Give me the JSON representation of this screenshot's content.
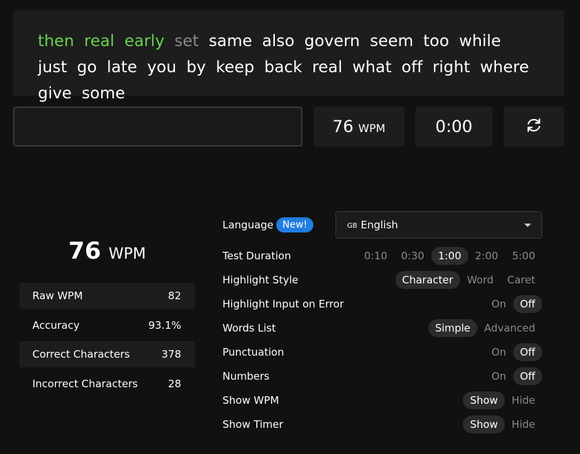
{
  "typing_text": {
    "completed": [
      "then",
      "real",
      "early"
    ],
    "current": "set",
    "pending": [
      "same",
      "also",
      "govern",
      "seem",
      "too",
      "while",
      "just",
      "go",
      "late",
      "you",
      "by",
      "keep",
      "back",
      "real",
      "what",
      "off",
      "right",
      "where",
      "give",
      "some"
    ]
  },
  "input": {
    "value": "",
    "placeholder": ""
  },
  "live_wpm": {
    "value": "76",
    "unit": "WPM"
  },
  "timer": "0:00",
  "restart_icon": "refresh-icon",
  "results": {
    "wpm": "76",
    "wpm_unit": "WPM",
    "stats": [
      {
        "label": "Raw WPM",
        "value": "82"
      },
      {
        "label": "Accuracy",
        "value": "93.1%"
      },
      {
        "label": "Correct Characters",
        "value": "378"
      },
      {
        "label": "Incorrect Characters",
        "value": "28"
      }
    ]
  },
  "settings": {
    "language": {
      "label": "Language",
      "badge": "New!",
      "flag": "GB",
      "value": "English"
    },
    "rows": [
      {
        "label": "Test Duration",
        "options": [
          "0:10",
          "0:30",
          "1:00",
          "2:00",
          "5:00"
        ],
        "selected": 2
      },
      {
        "label": "Highlight Style",
        "options": [
          "Character",
          "Word",
          "Caret"
        ],
        "selected": 0
      },
      {
        "label": "Highlight Input on Error",
        "options": [
          "On",
          "Off"
        ],
        "selected": 1
      },
      {
        "label": "Words List",
        "options": [
          "Simple",
          "Advanced"
        ],
        "selected": 0
      },
      {
        "label": "Punctuation",
        "options": [
          "On",
          "Off"
        ],
        "selected": 1
      },
      {
        "label": "Numbers",
        "options": [
          "On",
          "Off"
        ],
        "selected": 1
      },
      {
        "label": "Show WPM",
        "options": [
          "Show",
          "Hide"
        ],
        "selected": 0
      },
      {
        "label": "Show Timer",
        "options": [
          "Show",
          "Hide"
        ],
        "selected": 0
      }
    ]
  },
  "colors": {
    "background": "#111111",
    "panel": "#1d1d1d",
    "completed_word": "#66d44f",
    "current_word": "#8a8a8a",
    "badge": "#1f7ee0"
  }
}
